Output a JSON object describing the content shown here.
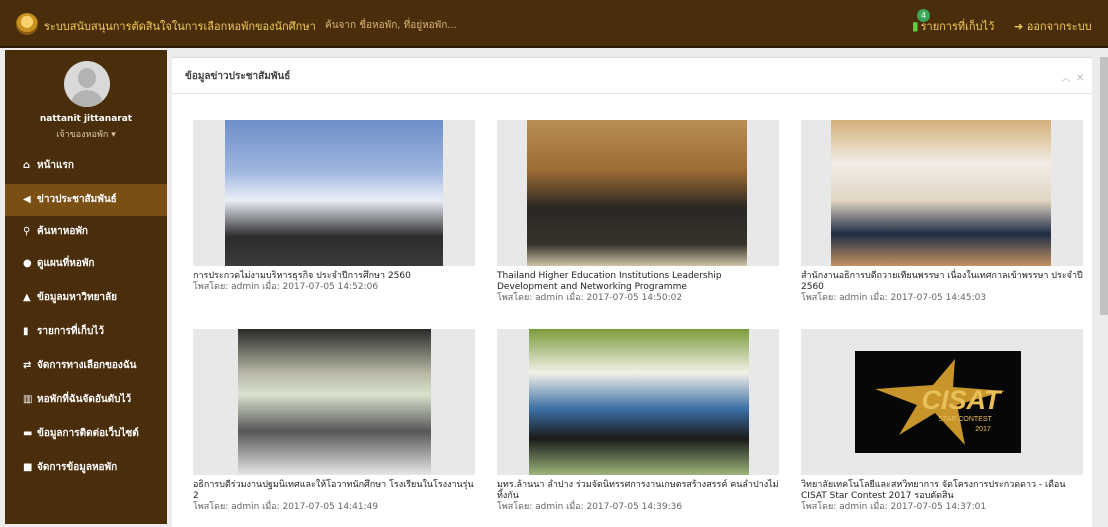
{
  "header": {
    "title": "ระบบสนับสนุนการตัดสินใจในการเลือกหอพักของนักศึกษา",
    "search_placeholder": "ค้นจาก ชื่อหอพัก, ที่อยู่หอพัก...",
    "saved_count": "4",
    "saved_label": "รายการที่เก็บไว้",
    "logout_label": "ออกจากระบบ"
  },
  "user": {
    "name": "nattanit jittanarat",
    "role": "เจ้าของหอพัก"
  },
  "nav": [
    {
      "icon": "home-icon",
      "glyph": "⌂",
      "label": "หน้าแรก"
    },
    {
      "icon": "megaphone-icon",
      "glyph": "◀",
      "label": "ข่าวประชาสัมพันธ์",
      "active": true
    },
    {
      "icon": "search-icon",
      "glyph": "⚲",
      "label": "ค้นหาหอพัก"
    },
    {
      "icon": "map-marker-icon",
      "glyph": "●",
      "label": "ดูแผนที่หอพัก"
    },
    {
      "icon": "graduation-cap-icon",
      "glyph": "▲",
      "label": "ข้อมูลมหาวิทยาลัย"
    },
    {
      "icon": "bookmark-icon",
      "glyph": "▮",
      "label": "รายการที่เก็บไว้"
    },
    {
      "icon": "exchange-icon",
      "glyph": "⇄",
      "label": "จัดการทางเลือกของฉัน"
    },
    {
      "icon": "bar-chart-icon",
      "glyph": "▥",
      "label": "หอพักที่ฉันจัดอันดับไว้"
    },
    {
      "icon": "comment-icon",
      "glyph": "▬",
      "label": "ข้อมูลการติดต่อเว็บไซต์"
    },
    {
      "icon": "square-icon",
      "glyph": "■",
      "label": "จัดการข้อมูลหอพัก"
    }
  ],
  "panel": {
    "title": "ข้อมูลข่าวประชาสัมพันธ์",
    "collapse_icon": "chevron-up-icon",
    "close_icon": "close-icon"
  },
  "news": [
    {
      "caption": "การประกวดไม่งามบริหารธุรกิจ ประจำปีการศึกษา 2560",
      "meta": "โพสโดย: admin เมื่อ: 2017-07-05 14:52:06"
    },
    {
      "caption": "Thailand Higher Education Institutions Leadership Development and Networking Programme",
      "meta": "โพสโดย: admin เมื่อ: 2017-07-05 14:50:02"
    },
    {
      "caption": "สำนักงานอธิการบดีถวายเทียนพรรษา เนื่องในเทศกาลเข้าพรรษา ประจำปี 2560",
      "meta": "โพสโดย: admin เมื่อ: 2017-07-05 14:45:03"
    },
    {
      "caption": "อธิการบดีร่วมงานปฐมนิเทศและให้โอวาทนักศึกษา โรงเรียนในโรงงานรุ่น 2",
      "meta": "โพสโดย: admin เมื่อ: 2017-07-05 14:41:49"
    },
    {
      "caption": "มทร.ล้านนา ลำปาง ร่วมจัดนิทรรศการงานเกษตรสร้างสรรค์ คนลำปางไม่ทิ้งกัน",
      "meta": "โพสโดย: admin เมื่อ: 2017-07-05 14:39:36"
    },
    {
      "caption": "วิทยาลัยเทคโนโลยีและสหวิทยาการ จัดโครงการประกวดดาว - เดือน CISAT Star Contest 2017 รอบตัดสิน",
      "meta": "โพสโดย: admin เมื่อ: 2017-07-05 14:37:01"
    }
  ],
  "logo_text": {
    "main": "CISAT",
    "sub": "STAR CONTEST",
    "year": "2017"
  }
}
